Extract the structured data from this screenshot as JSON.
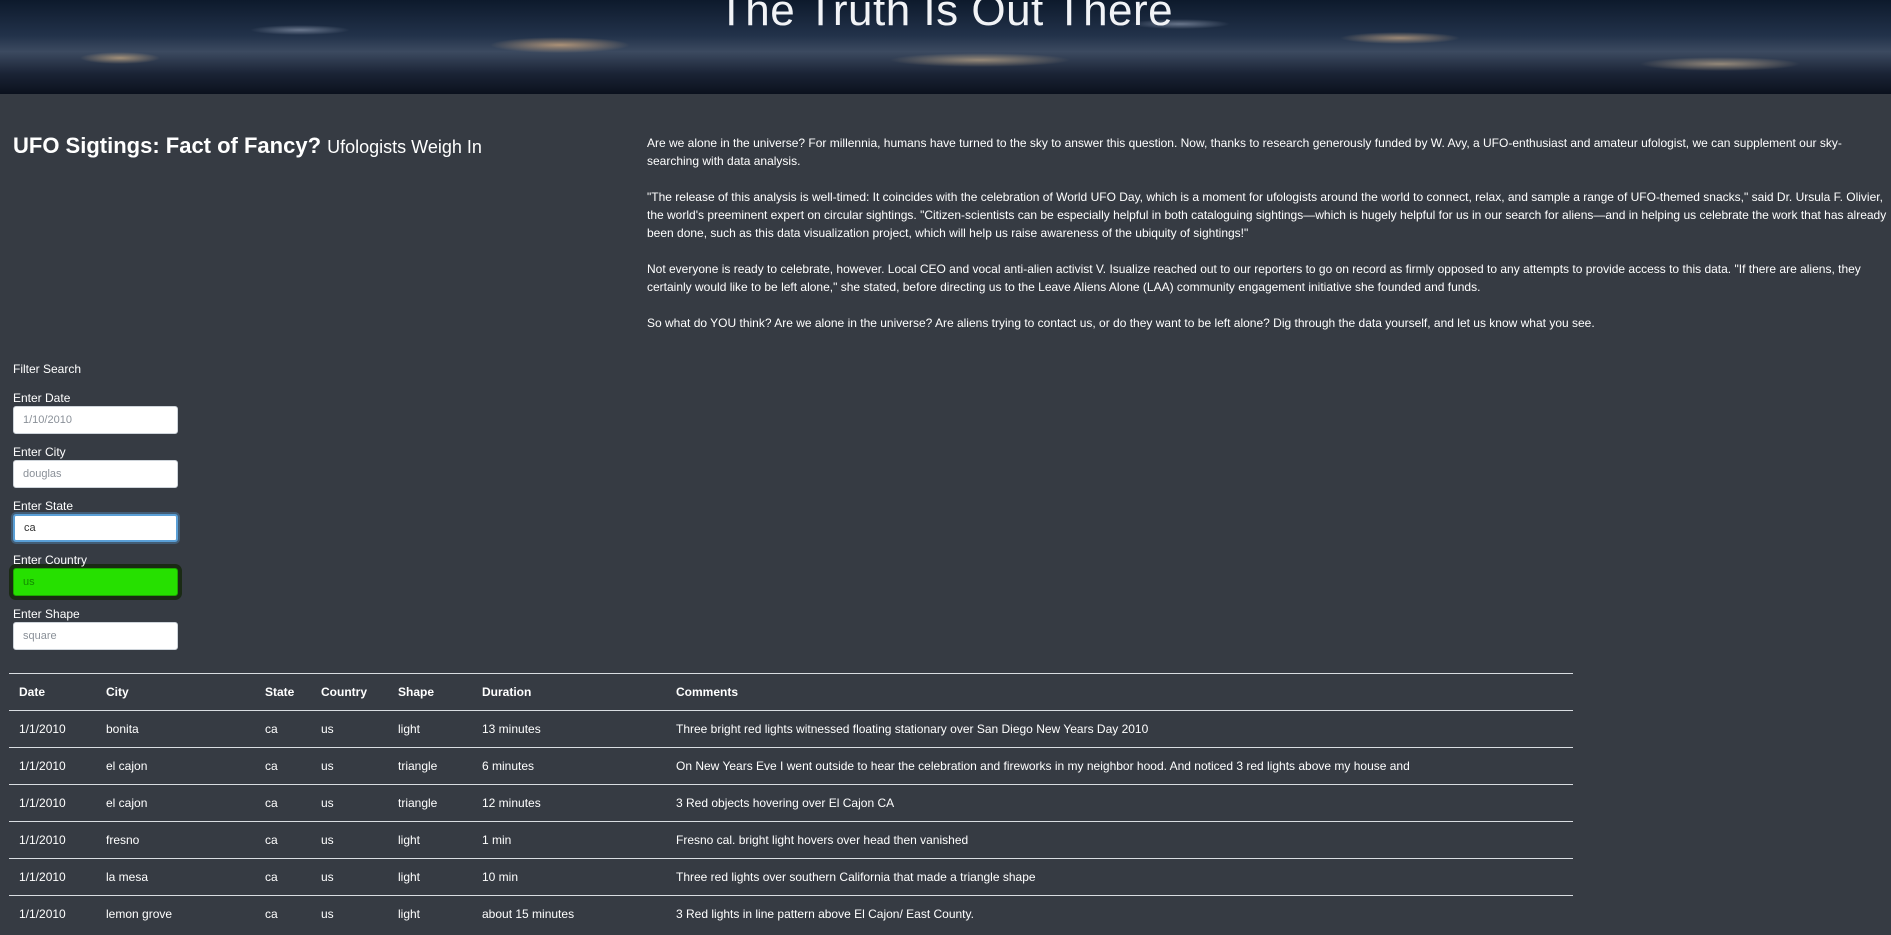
{
  "hero": {
    "title": "The Truth Is Out There"
  },
  "headline": {
    "main": "UFO Sigtings: Fact of Fancy?",
    "sub": "Ufologists Weigh In"
  },
  "intro": {
    "paragraphs": [
      "Are we alone in the universe? For millennia, humans have turned to the sky to answer this question. Now, thanks to research generously funded by W. Avy, a UFO-enthusiast and amateur ufologist, we can supplement our sky-searching with data analysis.",
      "\"The release of this analysis is well-timed: It coincides with the celebration of World UFO Day, which is a moment for ufologists around the world to connect, relax, and sample a range of UFO-themed snacks,\" said Dr. Ursula F. Olivier, the world's preeminent expert on circular sightings. \"Citizen-scientists can be especially helpful in both cataloguing sightings—which is hugely helpful for us in our search for aliens—and in helping us celebrate the work that has already been done, such as this data visualization project, which will help us raise awareness of the ubiquity of sightings!\"",
      "Not everyone is ready to celebrate, however. Local CEO and vocal anti-alien activist V. Isualize reached out to our reporters to go on record as firmly opposed to any attempts to provide access to this data. \"If there are aliens, they certainly would like to be left alone,\" she stated, before directing us to the Leave Aliens Alone (LAA) community engagement initiative she founded and funds.",
      "So what do YOU think? Are we alone in the universe? Are aliens trying to contact us, or do they want to be left alone? Dig through the data yourself, and let us know what you see."
    ]
  },
  "filter": {
    "heading": "Filter Search",
    "fields": [
      {
        "label": "Enter Date",
        "value": "",
        "placeholder": "1/10/2010"
      },
      {
        "label": "Enter City",
        "value": "",
        "placeholder": "douglas"
      },
      {
        "label": "Enter State",
        "value": "ca",
        "placeholder": ""
      },
      {
        "label": "Enter Country",
        "value": "",
        "placeholder": "us"
      },
      {
        "label": "Enter Shape",
        "value": "",
        "placeholder": "square"
      }
    ]
  },
  "table": {
    "headers": [
      "Date",
      "City",
      "State",
      "Country",
      "Shape",
      "Duration",
      "Comments"
    ],
    "rows": [
      [
        "1/1/2010",
        "bonita",
        "ca",
        "us",
        "light",
        "13 minutes",
        "Three bright red lights witnessed floating stationary over San Diego New Years Day 2010"
      ],
      [
        "1/1/2010",
        "el cajon",
        "ca",
        "us",
        "triangle",
        "6 minutes",
        "On New Years Eve I went outside to hear the celebration and fireworks in my neighbor hood. And noticed 3 red lights above my house and"
      ],
      [
        "1/1/2010",
        "el cajon",
        "ca",
        "us",
        "triangle",
        "12 minutes",
        "3 Red objects hovering over El Cajon CA"
      ],
      [
        "1/1/2010",
        "fresno",
        "ca",
        "us",
        "light",
        "1 min",
        "Fresno cal. bright light hovers over head then vanished"
      ],
      [
        "1/1/2010",
        "la mesa",
        "ca",
        "us",
        "light",
        "10 min",
        "Three red lights over southern California that made a triangle shape"
      ],
      [
        "1/1/2010",
        "lemon grove",
        "ca",
        "us",
        "light",
        "about 15 minutes",
        "3 Red lights in line pattern above El Cajon/ East County."
      ]
    ]
  }
}
